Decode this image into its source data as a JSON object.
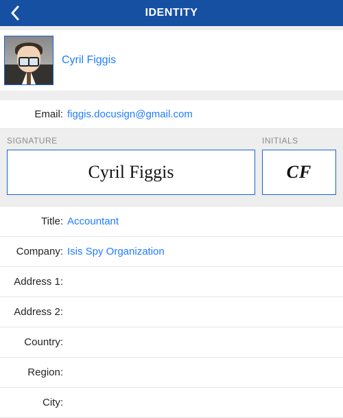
{
  "header": {
    "title": "IDENTITY"
  },
  "profile": {
    "name": "Cyril Figgis"
  },
  "email": {
    "label": "Email:",
    "value": "figgis.docusign@gmail.com"
  },
  "signature": {
    "heading": "SIGNATURE",
    "value": "Cyril Figgis"
  },
  "initials": {
    "heading": "INITIALS",
    "value": "CF"
  },
  "fields": {
    "title": {
      "label": "Title:",
      "value": "Accountant"
    },
    "company": {
      "label": "Company:",
      "value": "Isis Spy Organization"
    },
    "address1": {
      "label": "Address 1:",
      "value": ""
    },
    "address2": {
      "label": "Address 2:",
      "value": ""
    },
    "country": {
      "label": "Country:",
      "value": ""
    },
    "region": {
      "label": "Region:",
      "value": ""
    },
    "city": {
      "label": "City:",
      "value": ""
    }
  }
}
